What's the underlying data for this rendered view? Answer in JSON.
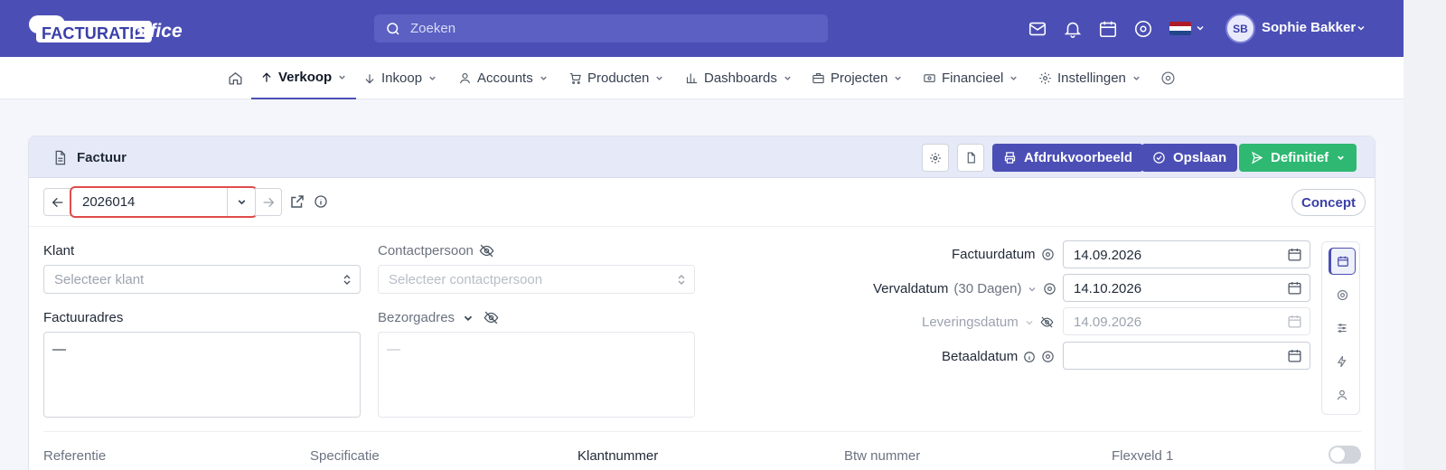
{
  "header": {
    "logo_text": "FACTURATIE",
    "logo_suffix": "office",
    "search_placeholder": "Zoeken",
    "user_initials": "SB",
    "user_name": "Sophie Bakker"
  },
  "nav": {
    "items": [
      {
        "label": "Verkoop",
        "icon": "arrow-up-icon"
      },
      {
        "label": "Inkoop",
        "icon": "arrow-down-icon"
      },
      {
        "label": "Accounts",
        "icon": "user-icon"
      },
      {
        "label": "Producten",
        "icon": "cart-icon"
      },
      {
        "label": "Dashboards",
        "icon": "bar-chart-icon"
      },
      {
        "label": "Projecten",
        "icon": "briefcase-icon"
      },
      {
        "label": "Financieel",
        "icon": "money-icon"
      },
      {
        "label": "Instellingen",
        "icon": "gear-icon"
      }
    ],
    "active": "Verkoop"
  },
  "invoice": {
    "title": "Factuur",
    "print_label": "Afdrukvoorbeeld",
    "save_label": "Opslaan",
    "final_label": "Definitief",
    "number": "2026014",
    "status": "Concept",
    "klant_label": "Klant",
    "klant_placeholder": "Selecteer klant",
    "contact_label": "Contactpersoon",
    "contact_placeholder": "Selecteer contactpersoon",
    "factuuradres_label": "Factuuradres",
    "factuuradres_value": "—",
    "bezorgadres_label": "Bezorgadres",
    "bezorgadres_value": "—",
    "factuurdatum_label": "Factuurdatum",
    "factuurdatum": "14.09.2026",
    "vervaldatum_label": "Vervaldatum",
    "vervaldatum_days": "(30 Dagen)",
    "vervaldatum": "14.10.2026",
    "leveringsdatum_label": "Leveringsdatum",
    "leveringsdatum": "14.09.2026",
    "betaaldatum_label": "Betaaldatum",
    "betaaldatum": "",
    "footer": [
      "Referentie",
      "Specificatie",
      "Klantnummer",
      "Btw nummer",
      "Flexveld 1"
    ]
  },
  "colors": {
    "brand": "#4b4fb5",
    "save": "#4b4fb5",
    "final": "#2eb872"
  }
}
